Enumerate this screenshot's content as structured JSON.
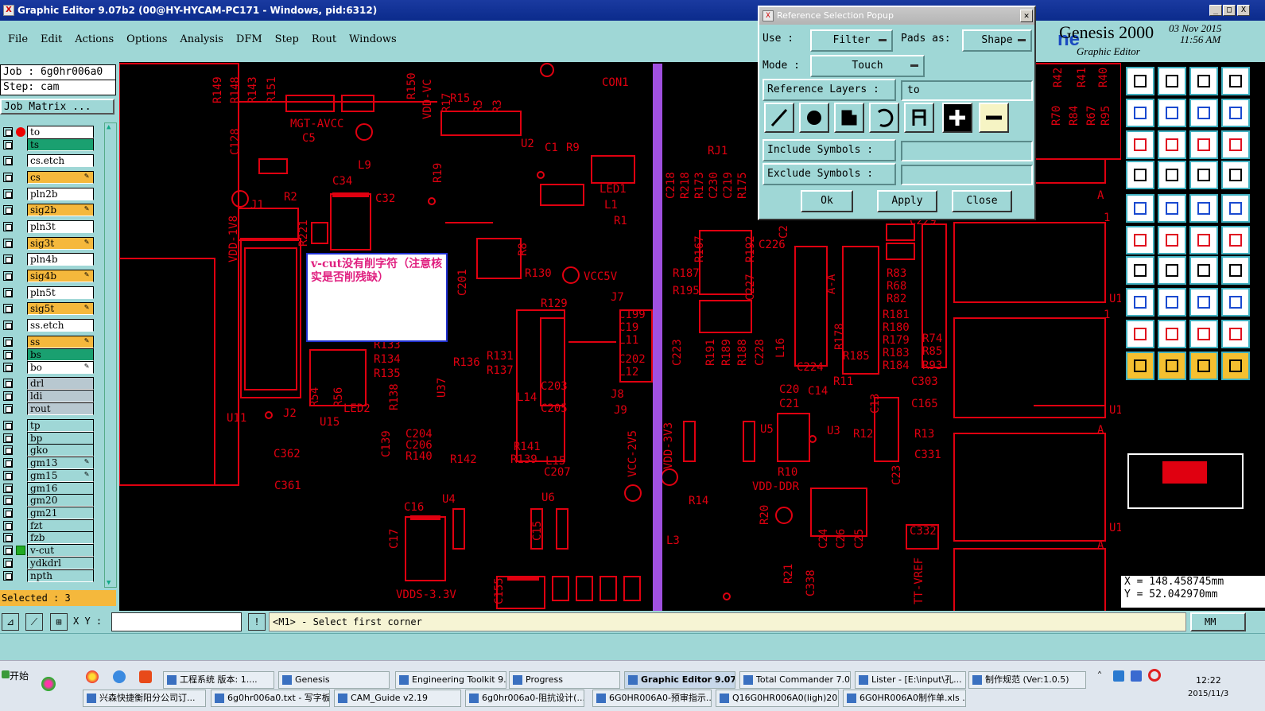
{
  "window": {
    "title": "Graphic Editor 9.07b2 (00@HY-HYCAM-PC171 - Windows, pid:6312)",
    "min": "_",
    "max": "□",
    "close": "X"
  },
  "menu": [
    "File",
    "Edit",
    "Actions",
    "Options",
    "Analysis",
    "DFM",
    "Step",
    "Rout",
    "Windows"
  ],
  "brand": {
    "name": "Genesis 2000",
    "sub": "Graphic Editor",
    "date": "03 Nov 2015",
    "time": "11:56 AM",
    "frag": "ne"
  },
  "job": {
    "job": "Job  : 6g0hr006a0",
    "step": "Step: cam",
    "matrix": "Job Matrix ..."
  },
  "layers": [
    {
      "name": "to",
      "bg": "#ffffff",
      "mark": "dot"
    },
    {
      "name": "ts",
      "bg": "#1aa070",
      "mark": ""
    },
    {
      "name": "cs.etch",
      "bg": "#ffffff",
      "mark": ""
    },
    {
      "name": "cs",
      "bg": "#f5b83c",
      "mark": "pen"
    },
    {
      "name": "pln2b",
      "bg": "#ffffff",
      "mark": ""
    },
    {
      "name": "sig2b",
      "bg": "#f5b83c",
      "mark": "pen"
    },
    {
      "name": "pln3t",
      "bg": "#ffffff",
      "mark": ""
    },
    {
      "name": "sig3t",
      "bg": "#f5b83c",
      "mark": "pen"
    },
    {
      "name": "pln4b",
      "bg": "#ffffff",
      "mark": ""
    },
    {
      "name": "sig4b",
      "bg": "#f5b83c",
      "mark": "pen"
    },
    {
      "name": "pln5t",
      "bg": "#ffffff",
      "mark": ""
    },
    {
      "name": "sig5t",
      "bg": "#f5b83c",
      "mark": "pen"
    },
    {
      "name": "ss.etch",
      "bg": "#ffffff",
      "mark": ""
    },
    {
      "name": "ss",
      "bg": "#f5b83c",
      "mark": "pen"
    },
    {
      "name": "bs",
      "bg": "#1aa070",
      "mark": ""
    },
    {
      "name": "bo",
      "bg": "#ffffff",
      "mark": "pen"
    },
    {
      "name": "drl",
      "bg": "#b8c8d0",
      "mark": ""
    },
    {
      "name": "ldi",
      "bg": "#b8c8d0",
      "mark": ""
    },
    {
      "name": "rout",
      "bg": "#b8c8d0",
      "mark": ""
    },
    {
      "name": "tp",
      "bg": "#9fd7d6",
      "mark": ""
    },
    {
      "name": "bp",
      "bg": "#9fd7d6",
      "mark": ""
    },
    {
      "name": "gko",
      "bg": "#9fd7d6",
      "mark": ""
    },
    {
      "name": "gm13",
      "bg": "#9fd7d6",
      "mark": "pen"
    },
    {
      "name": "gm15",
      "bg": "#9fd7d6",
      "mark": "pen"
    },
    {
      "name": "gm16",
      "bg": "#9fd7d6",
      "mark": ""
    },
    {
      "name": "gm20",
      "bg": "#9fd7d6",
      "mark": ""
    },
    {
      "name": "gm21",
      "bg": "#9fd7d6",
      "mark": ""
    },
    {
      "name": "fzt",
      "bg": "#9fd7d6",
      "mark": ""
    },
    {
      "name": "fzb",
      "bg": "#9fd7d6",
      "mark": ""
    },
    {
      "name": "v-cut",
      "bg": "#9fd7d6",
      "mark": "sq"
    },
    {
      "name": "ydkdrl",
      "bg": "#9fd7d6",
      "mark": ""
    },
    {
      "name": "npth",
      "bg": "#9fd7d6",
      "mark": ""
    }
  ],
  "selected": "Selected : 3",
  "popup": {
    "title": "Reference Selection Popup",
    "use_label": "Use   :",
    "use_value": "Filter",
    "pads_label": "Pads as:",
    "pads_value": "Shape",
    "mode_label": "Mode  :",
    "mode_value": "Touch",
    "ref_label": "Reference Layers :",
    "ref_value": "to",
    "incl_label": "Include Symbols :",
    "excl_label": "Exclude Symbols :",
    "ok": "Ok",
    "apply": "Apply",
    "close": "Close"
  },
  "note": "v-cut没有削字符（注意核实是否削残缺）",
  "coords": {
    "x": "X  =  148.458745mm",
    "y": "Y  =  52.042970mm"
  },
  "cmd": {
    "xy_label": "X Y :",
    "prompt": "<M1> - Select first corner",
    "units": "MM"
  },
  "pcb_labels": [
    [
      "R149",
      278,
      130,
      -90
    ],
    [
      "R148",
      300,
      130,
      -90
    ],
    [
      "R143",
      322,
      130,
      -90
    ],
    [
      "R151",
      346,
      130,
      -90
    ],
    [
      "R150",
      522,
      125,
      -90
    ],
    [
      "VDD-VC",
      542,
      150,
      -90
    ],
    [
      "MGT-AVCC",
      365,
      160,
      0
    ],
    [
      "C5",
      380,
      178,
      0
    ],
    [
      "C128",
      300,
      195,
      -90
    ],
    [
      "L9",
      450,
      212,
      0
    ],
    [
      "C34",
      418,
      232,
      0
    ],
    [
      "R2",
      357,
      252,
      0
    ],
    [
      "C32",
      472,
      254,
      0
    ],
    [
      "J1",
      315,
      262,
      0
    ],
    [
      "VDD-1V8",
      298,
      330,
      -90
    ],
    [
      "R221",
      386,
      310,
      -90
    ],
    [
      "R15",
      566,
      128,
      0
    ],
    [
      "R17",
      566,
      142,
      -90
    ],
    [
      "R5",
      606,
      142,
      -90
    ],
    [
      "R3",
      630,
      142,
      -90
    ],
    [
      "CON1",
      757,
      108,
      0
    ],
    [
      "U2",
      655,
      185,
      0
    ],
    [
      "C1",
      685,
      190,
      0
    ],
    [
      "R9",
      712,
      190,
      0
    ],
    [
      "R19",
      555,
      230,
      -90
    ],
    [
      "LED1",
      754,
      242,
      0
    ],
    [
      "L1",
      760,
      262,
      0
    ],
    [
      "R1",
      772,
      282,
      0
    ],
    [
      "R8",
      662,
      322,
      -90
    ],
    [
      "R130",
      660,
      348,
      0
    ],
    [
      "VCC5V",
      734,
      352,
      0
    ],
    [
      "J7",
      768,
      378,
      0
    ],
    [
      "R129",
      680,
      386,
      0
    ],
    [
      "C199",
      778,
      400,
      0
    ],
    [
      "C19",
      778,
      416,
      0
    ],
    [
      "L11",
      778,
      432,
      0
    ],
    [
      "C202",
      778,
      456,
      0
    ],
    [
      "L12",
      778,
      472,
      0
    ],
    [
      "R131",
      612,
      452,
      0
    ],
    [
      "R137",
      612,
      470,
      0
    ],
    [
      "R136",
      570,
      460,
      0
    ],
    [
      "R133",
      470,
      438,
      0
    ],
    [
      "R134",
      470,
      456,
      0
    ],
    [
      "R135",
      470,
      474,
      0
    ],
    [
      "U37",
      560,
      500,
      -90
    ],
    [
      "C201",
      586,
      372,
      -90
    ],
    [
      "R138",
      500,
      516,
      -90
    ],
    [
      "R54",
      400,
      512,
      -90
    ],
    [
      "R56",
      430,
      512,
      -90
    ],
    [
      "LED2",
      432,
      518,
      0
    ],
    [
      "U11",
      285,
      530,
      0
    ],
    [
      "J2",
      356,
      524,
      0
    ],
    [
      "U15",
      402,
      535,
      0
    ],
    [
      "C139",
      490,
      575,
      -90
    ],
    [
      "C203",
      680,
      490,
      0
    ],
    [
      "L14",
      650,
      504,
      0
    ],
    [
      "J8",
      768,
      500,
      0
    ],
    [
      "J9",
      772,
      520,
      0
    ],
    [
      "C205",
      680,
      518,
      0
    ],
    [
      "C204",
      510,
      550,
      0
    ],
    [
      "C206",
      510,
      564,
      0
    ],
    [
      "R140",
      510,
      578,
      0
    ],
    [
      "R142",
      566,
      582,
      0
    ],
    [
      "R141",
      646,
      566,
      0
    ],
    [
      "R139",
      642,
      582,
      0
    ],
    [
      "L15",
      686,
      584,
      0
    ],
    [
      "C207",
      684,
      598,
      0
    ],
    [
      "VCC-2V5",
      800,
      600,
      -90
    ],
    [
      "C362",
      344,
      575,
      0
    ],
    [
      "C361",
      345,
      615,
      0
    ],
    [
      "U4",
      556,
      632,
      0
    ],
    [
      "U6",
      681,
      630,
      0
    ],
    [
      "C16",
      508,
      642,
      0
    ],
    [
      "C17",
      500,
      690,
      -90
    ],
    [
      "C15",
      680,
      680,
      -90
    ],
    [
      "VDDS-3.3V",
      498,
      752,
      0
    ],
    [
      "C155",
      632,
      760,
      -90
    ],
    [
      "VDD-3V3",
      845,
      590,
      -90
    ],
    [
      "RJ1",
      890,
      194,
      0
    ],
    [
      "C218",
      848,
      250,
      -90
    ],
    [
      "R218",
      866,
      250,
      -90
    ],
    [
      "R173",
      884,
      250,
      -90
    ],
    [
      "C230",
      902,
      250,
      -90
    ],
    [
      "C219",
      920,
      250,
      -90
    ],
    [
      "R175",
      938,
      250,
      -90
    ],
    [
      "R167",
      884,
      330,
      -90
    ],
    [
      "R187",
      846,
      348,
      0
    ],
    [
      "R195",
      846,
      370,
      0
    ],
    [
      "R192",
      948,
      330,
      -90
    ],
    [
      "C227",
      948,
      378,
      -90
    ],
    [
      "C226",
      954,
      312,
      0
    ],
    [
      "C2",
      990,
      300,
      -90
    ],
    [
      "C223",
      856,
      460,
      -90
    ],
    [
      "R191",
      898,
      460,
      -90
    ],
    [
      "R189",
      918,
      460,
      -90
    ],
    [
      "R188",
      938,
      460,
      -90
    ],
    [
      "C228",
      960,
      460,
      -90
    ],
    [
      "L16",
      986,
      450,
      -90
    ],
    [
      "R178",
      1060,
      440,
      -90
    ],
    [
      "C224",
      1002,
      466,
      0
    ],
    [
      "R185",
      1060,
      452,
      0
    ],
    [
      "R83",
      1115,
      348,
      0
    ],
    [
      "R68",
      1115,
      364,
      0
    ],
    [
      "R82",
      1115,
      380,
      0
    ],
    [
      "R181",
      1110,
      400,
      0
    ],
    [
      "R180",
      1110,
      416,
      0
    ],
    [
      "R179",
      1110,
      432,
      0
    ],
    [
      "R183",
      1110,
      448,
      0
    ],
    [
      "R184",
      1110,
      464,
      0
    ],
    [
      "R74",
      1160,
      430,
      0
    ],
    [
      "R85",
      1160,
      446,
      0
    ],
    [
      "R93",
      1160,
      464,
      0
    ],
    [
      "R11",
      1048,
      484,
      0
    ],
    [
      "C20",
      980,
      494,
      0
    ],
    [
      "C14",
      1016,
      496,
      0
    ],
    [
      "C21",
      980,
      512,
      0
    ],
    [
      "C13",
      1105,
      520,
      -90
    ],
    [
      "C303",
      1146,
      484,
      0
    ],
    [
      "C165",
      1146,
      512,
      0
    ],
    [
      "U5",
      956,
      544,
      0
    ],
    [
      "U3",
      1040,
      546,
      0
    ],
    [
      "R12",
      1073,
      550,
      0
    ],
    [
      "R13",
      1150,
      550,
      0
    ],
    [
      "C331",
      1150,
      576,
      0
    ],
    [
      "R10",
      978,
      598,
      0
    ],
    [
      "VDD-DDR",
      946,
      616,
      0
    ],
    [
      "C23",
      1132,
      610,
      -90
    ],
    [
      "R14",
      866,
      634,
      0
    ],
    [
      "R20",
      966,
      660,
      -90
    ],
    [
      "C24",
      1040,
      690,
      -90
    ],
    [
      "C26",
      1062,
      690,
      -90
    ],
    [
      "C25",
      1085,
      690,
      -90
    ],
    [
      "C332",
      1144,
      672,
      0
    ],
    [
      "L3",
      838,
      684,
      0
    ],
    [
      "R21",
      996,
      734,
      -90
    ],
    [
      "C338",
      1024,
      750,
      -90
    ],
    [
      "TT-VREF",
      1160,
      760,
      -90
    ],
    [
      "R42",
      1335,
      110,
      -90
    ],
    [
      "R41",
      1365,
      110,
      -90
    ],
    [
      "R40",
      1392,
      110,
      -90
    ],
    [
      "R70",
      1333,
      158,
      -90
    ],
    [
      "R84",
      1355,
      158,
      -90
    ],
    [
      "R67",
      1377,
      158,
      -90
    ],
    [
      "R95",
      1395,
      158,
      -90
    ],
    [
      "C229",
      1144,
      282,
      0
    ],
    [
      "A-A",
      1050,
      370,
      -90
    ],
    [
      "A",
      1380,
      250,
      0
    ],
    [
      "A",
      1380,
      545,
      0
    ],
    [
      "A",
      1380,
      690,
      0
    ],
    [
      "U1",
      1395,
      380,
      0
    ],
    [
      "U1",
      1395,
      520,
      0
    ],
    [
      "U1",
      1395,
      668,
      0
    ],
    [
      "1",
      1388,
      278,
      0
    ],
    [
      "1",
      1388,
      400,
      0
    ]
  ],
  "taskbar": {
    "start": "开始",
    "items": [
      [
        "工程系统  版本: 1....",
        205,
        843,
        140
      ],
      [
        "Genesis",
        350,
        843,
        140
      ],
      [
        "Engineering Toolkit 9....",
        497,
        843,
        140
      ],
      [
        "Progress",
        640,
        843,
        140
      ],
      [
        "Graphic Editor 9.07...",
        785,
        843,
        140
      ],
      [
        "Total Commander 7.0 ...",
        930,
        843,
        140
      ],
      [
        "Lister - [E:\\input\\孔...",
        1075,
        843,
        140
      ],
      [
        "制作规范 (Ver:1.0.5)",
        1218,
        843,
        148
      ],
      [
        "兴森快捷衡阳分公司订...",
        104,
        866,
        155
      ],
      [
        "6g0hr006a0.txt - 写字板",
        265,
        866,
        150
      ],
      [
        "CAM_Guide v2.19",
        420,
        866,
        160
      ],
      [
        "6g0hr006a0-阻抗设计(...",
        585,
        866,
        150
      ],
      [
        "6G0HR006A0-预审指示...",
        745,
        866,
        150
      ],
      [
        "Q16G0HR006A0(ligh)201...",
        900,
        866,
        155
      ],
      [
        "6G0HR006A0制作单.xls ...",
        1060,
        866,
        155
      ]
    ],
    "time": "12:22",
    "date": "2015/11/3"
  }
}
